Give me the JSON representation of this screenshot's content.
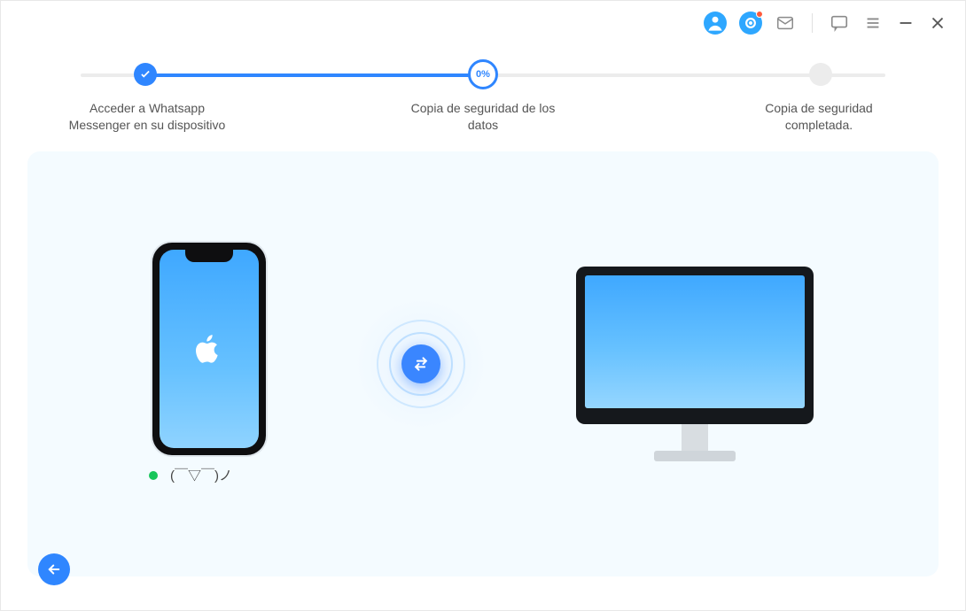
{
  "steps": {
    "s1": {
      "label_l1": "Acceder a Whatsapp",
      "label_l2": "Messenger en su dispositivo",
      "state": "done"
    },
    "s2": {
      "label_l1": "Copia de seguridad de los",
      "label_l2": "datos",
      "state": "active",
      "percent_label": "0%"
    },
    "s3": {
      "label_l1": "Copia de seguridad",
      "label_l2": "completada.",
      "state": "pending"
    }
  },
  "progress": {
    "fill_percent": 50
  },
  "device": {
    "status_dot_color": "#17c55a",
    "name": "(￣▽￣)ノ"
  },
  "titlebar_icons": {
    "account": "account-icon",
    "cloud": "cloud-icon",
    "mail": "mail-icon",
    "feedback": "feedback-icon",
    "menu": "menu-icon",
    "minimize": "minimize-icon",
    "close": "close-icon"
  }
}
